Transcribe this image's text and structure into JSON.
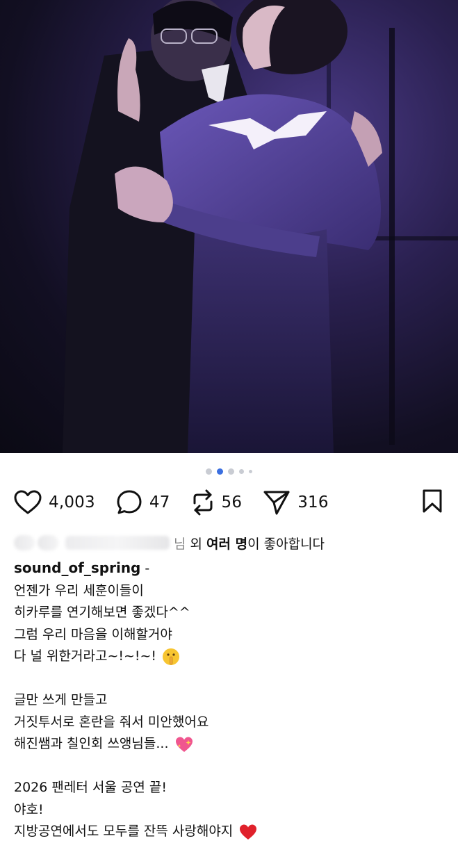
{
  "post": {
    "image_alt": "stage performance photo",
    "carousel": {
      "count": 5,
      "active_index": 1
    }
  },
  "actions": {
    "likes": "4,003",
    "comments": "47",
    "reposts": "56",
    "shares": "316"
  },
  "liked_by": {
    "prefix_hidden": "님",
    "middle": " 외 ",
    "bold": "여러 명",
    "suffix": "이 좋아합니다"
  },
  "caption": {
    "username": "sound_of_spring",
    "separator": " -",
    "lines": [
      "언젠가 우리 세훈이들이",
      "히카루를 연기해보면 좋겠다^^",
      "그럼 우리 마음을 이해할거야",
      "다 널 위한거라고~!~!~!",
      "",
      "글만 쓰게 만들고",
      "거짓투서로 혼란을 줘서 미안했어요",
      "해진쌤과 칠인회 쓰앵님들...",
      "",
      "2026 팬레터 서울 공연 끝!",
      "야호!",
      "지방공연에서도 모두를 잔뜩 사랑해야지"
    ]
  },
  "icons": {
    "line4": "shushing-face-emoji",
    "line8": "sparkling-heart-emoji",
    "line12": "red-heart-emoji"
  },
  "colors": {
    "carousel_active": "#3b6fe0",
    "carousel_inactive": "#c9ccd3",
    "heart_red": "#e0212b"
  }
}
